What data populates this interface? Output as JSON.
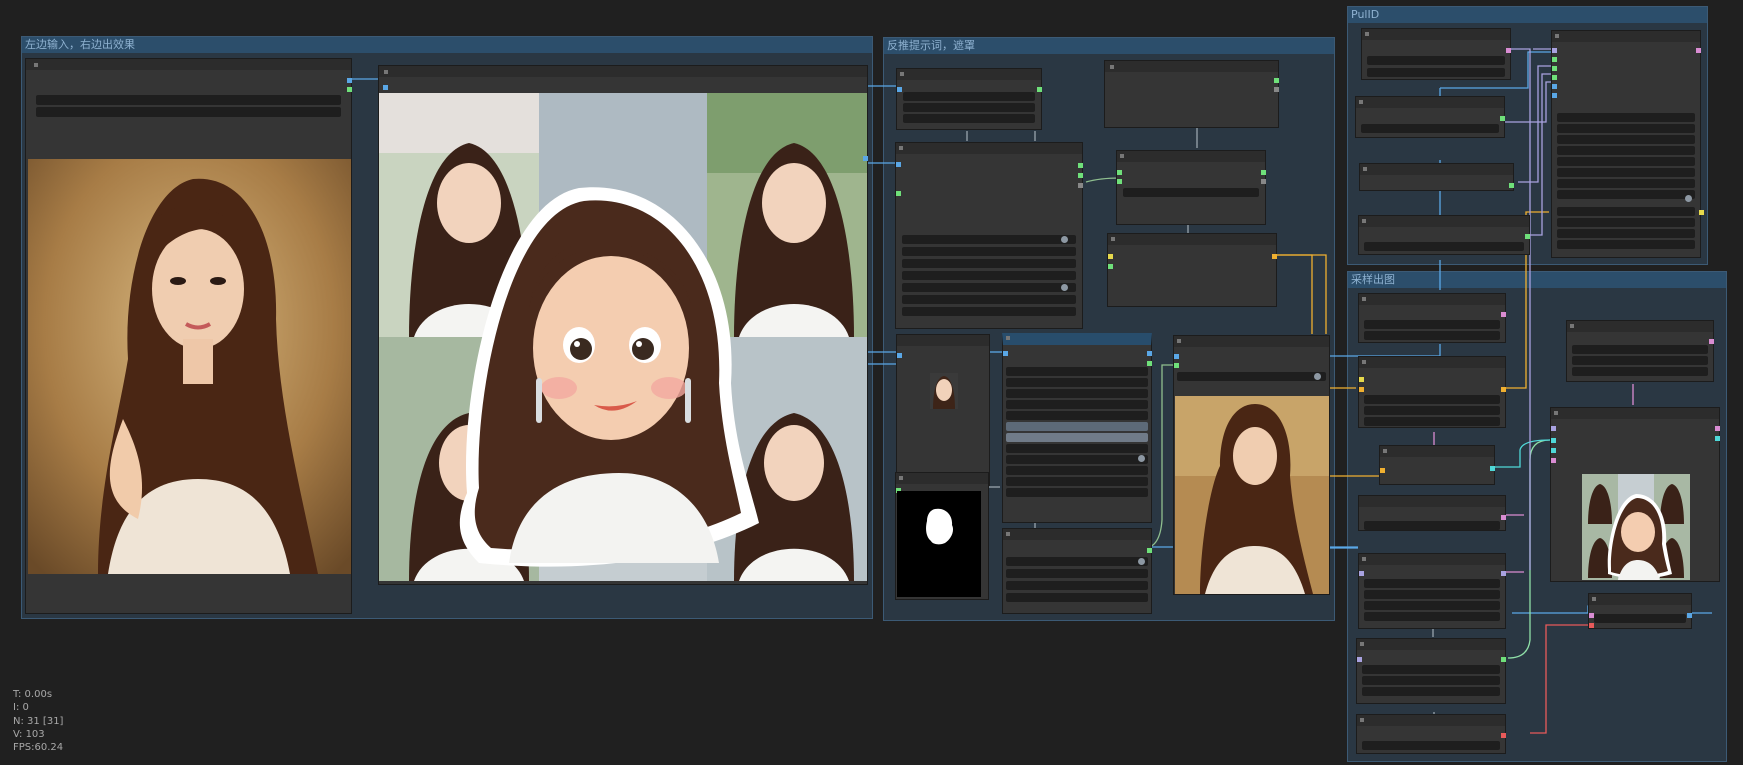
{
  "groups": [
    {
      "id": "group-input-output",
      "title": "左边输入，右边出效果"
    },
    {
      "id": "group-prompt-mask",
      "title": "反推提示词，遮罩"
    },
    {
      "id": "group-pulid",
      "title": "PulID"
    },
    {
      "id": "group-sampling",
      "title": "采样出图"
    }
  ],
  "stats": {
    "t": "T: 0.00s",
    "i": "I: 0",
    "n": "N: 31 [31]",
    "v": "V: 103",
    "fps": "FPS:60.24"
  },
  "icons": {
    "node_collapse": "node-collapse-dot-icon"
  },
  "colors": {
    "canvas": "#202020",
    "group_fill": "#2a3743",
    "group_header": "#2c4e6b",
    "node": "#353535",
    "wire_image": "#5aa7e6",
    "wire_model": "#a9a2e0",
    "wire_conditioning": "#f0b030",
    "wire_latent": "#d98cd2",
    "wire_vae": "#e85a5a"
  }
}
